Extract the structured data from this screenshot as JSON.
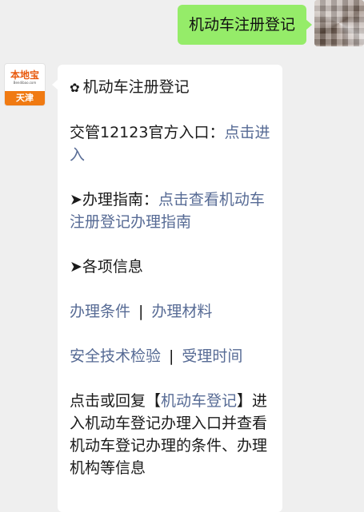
{
  "user_message": {
    "text": "机动车注册登记"
  },
  "bot": {
    "avatar_logo": "本地宝",
    "avatar_sub": "Bendibao.com",
    "avatar_city": "天津"
  },
  "reply": {
    "heading_icon": "✿",
    "heading": "机动车注册登记",
    "entry_prefix": "交管12123官方入口：",
    "entry_link": "点击进入",
    "guide_prefix": "➤办理指南：",
    "guide_link": "点击查看机动车注册登记办理指南",
    "info_heading": "➤各项信息",
    "link_conditions": "办理条件",
    "link_materials": "办理材料",
    "link_safety": "安全技术检验",
    "link_time": "受理时间",
    "separator": "|",
    "tip_prefix": "点击或回复【",
    "tip_keyword": "机动车登记",
    "tip_suffix": "】进入机动车登记办理入口并查看机动车登记办理的条件、办理机构等信息"
  }
}
